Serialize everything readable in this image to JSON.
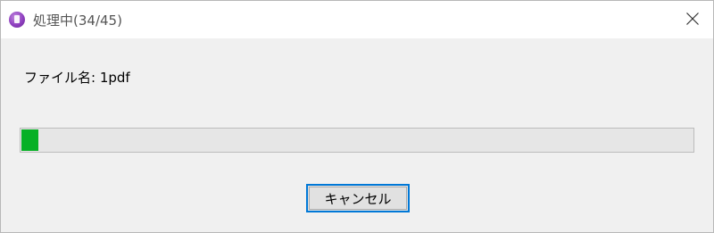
{
  "window": {
    "title": "処理中(34/45)",
    "icon": "app-icon"
  },
  "content": {
    "filename_label": "ファイル名: 1pdf"
  },
  "progress": {
    "fraction": 0.025,
    "color": "#06b025"
  },
  "buttons": {
    "cancel_label": "キャンセル",
    "close_icon": "close-icon"
  },
  "colors": {
    "accent_border": "#0078d7"
  }
}
